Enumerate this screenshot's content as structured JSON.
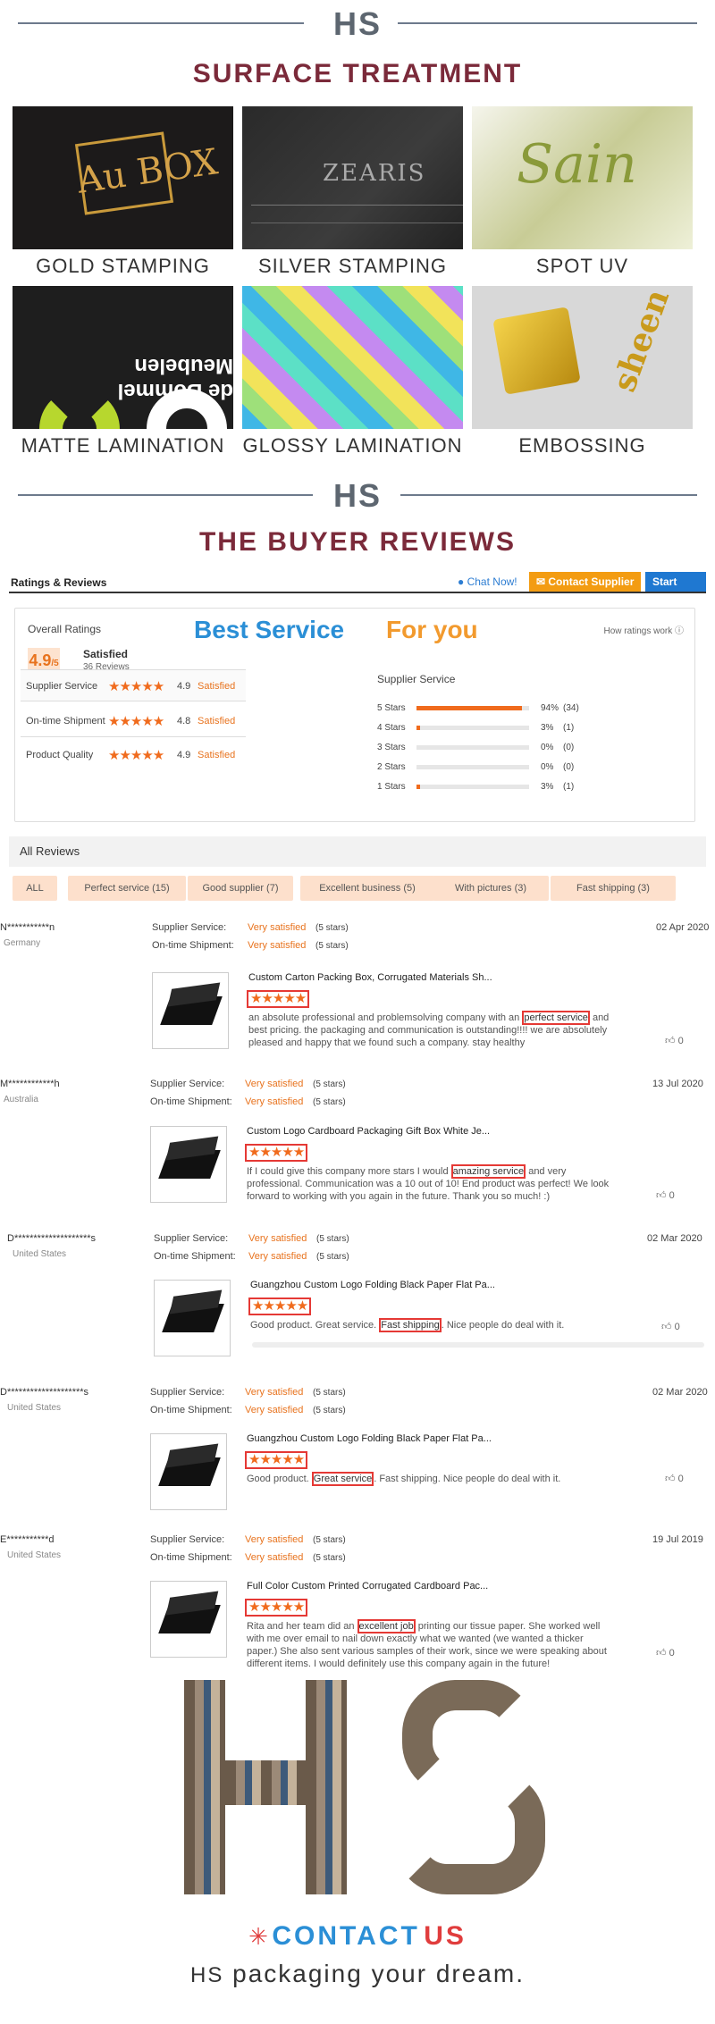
{
  "brand": "HS",
  "surface": {
    "title": "SURFACE TREATMENT",
    "tiles": [
      {
        "label": "GOLD STAMPING",
        "art": "Au BOX"
      },
      {
        "label": "SILVER STAMPING",
        "art": "ZEARIS"
      },
      {
        "label": "SPOT UV",
        "art": "Sain"
      },
      {
        "label": "MATTE LAMINATION",
        "art": "de Bommel Meubelen"
      },
      {
        "label": "GLOSSY LAMINATION",
        "art": ""
      },
      {
        "label": "EMBOSSING",
        "art": "sheen"
      }
    ]
  },
  "reviews_title": "THE BUYER REVIEWS",
  "panel": {
    "title": "Ratings & Reviews",
    "chat": "Chat Now!",
    "contact": "Contact Supplier",
    "order": "Start Order",
    "overall_label": "Overall Ratings",
    "score": "4.9",
    "score_out": "/5",
    "satisfied": "Satisfied",
    "reviews_count": "36 Reviews",
    "big1": "Best Service",
    "big2": "For you",
    "how": "How ratings work",
    "rows": [
      {
        "name": "Supplier Service",
        "stars": "★★★★★",
        "value": "4.9",
        "status": "Satisfied"
      },
      {
        "name": "On-time Shipment",
        "stars": "★★★★★",
        "value": "4.8",
        "status": "Satisfied"
      },
      {
        "name": "Product Quality",
        "stars": "★★★★★",
        "value": "4.9",
        "status": "Satisfied"
      }
    ],
    "supplier_service": "Supplier Service",
    "bars": [
      {
        "k": "5 Stars",
        "pct": 94,
        "p": "94%",
        "c": "(34)"
      },
      {
        "k": "4 Stars",
        "pct": 3,
        "p": "3%",
        "c": "(1)"
      },
      {
        "k": "3 Stars",
        "pct": 0,
        "p": "0%",
        "c": "(0)"
      },
      {
        "k": "2 Stars",
        "pct": 0,
        "p": "0%",
        "c": "(0)"
      },
      {
        "k": "1 Stars",
        "pct": 3,
        "p": "3%",
        "c": "(1)"
      }
    ]
  },
  "all_reviews": "All Reviews",
  "filters": [
    "ALL",
    "Perfect service (15)",
    "Good supplier (7)",
    "Excellent business (5)",
    "With pictures (3)",
    "Fast shipping (3)"
  ],
  "labels": {
    "supplier_service": "Supplier Service:",
    "ontime": "On-time Shipment:",
    "very_satisfied": "Very satisfied",
    "five_stars": "(5 stars)"
  },
  "reviews": [
    {
      "name": "N***********n",
      "country": "Germany",
      "date": "02 Apr 2020",
      "product": "Custom Carton Packing Box, Corrugated Materials Sh...",
      "stars": "★★★★★",
      "pre": "an absolute professional and problemsolving company with an ",
      "hl": "perfect service",
      "post": " and best pricing. the packaging and communication is outstanding!!!! we are absolutely pleased and happy that we found such a company. stay healthy",
      "likes": "0"
    },
    {
      "name": "M************h",
      "country": "Australia",
      "date": "13 Jul 2020",
      "product": "Custom Logo Cardboard Packaging Gift Box White Je...",
      "stars": "★★★★★",
      "pre": "If I could give this company more stars I would ",
      "hl": "amazing service",
      "post": " and very professional. Communication was a 10 out of 10! End product was perfect! We look forward to working with you again in the future. Thank you so much! :)",
      "likes": "0"
    },
    {
      "name": "D********************s",
      "country": "United States",
      "date": "02 Mar 2020",
      "product": "Guangzhou Custom Logo Folding Black Paper Flat Pa...",
      "stars": "★★★★★",
      "pre": "Good product. Great service. ",
      "hl": "Fast shipping",
      "post": ". Nice people do deal with it.",
      "likes": "0"
    },
    {
      "name": "D********************s",
      "country": "United States",
      "date": "02 Mar 2020",
      "product": "Guangzhou Custom Logo Folding Black Paper Flat Pa...",
      "stars": "★★★★★",
      "pre": "Good product. ",
      "hl": "Great service",
      "post": ". Fast shipping. Nice people do deal with it.",
      "likes": "0"
    },
    {
      "name": "E***********d",
      "country": "United States",
      "date": "19 Jul 2019",
      "product": "Full Color Custom Printed Corrugated Cardboard Pac...",
      "stars": "★★★★★",
      "pre": "Rita and her team did an ",
      "hl": "excellent job",
      "post": " printing our tissue paper. She worked well with me over email to nail down exactly what we wanted (we wanted a thicker paper.) She also sent various samples of their work, since we were speaking about different items.  I would definitely use this company again in the future!",
      "likes": "0"
    }
  ],
  "contact": {
    "c1": "CONTACT",
    "c2": "US",
    "tag_brand": "HS",
    "tagline": "packaging your dream."
  },
  "colors": {
    "title": "#7b2a3a",
    "accent_orange": "#f06b1d",
    "accent_blue": "#2b8fd6",
    "highlight": "#e53935"
  }
}
